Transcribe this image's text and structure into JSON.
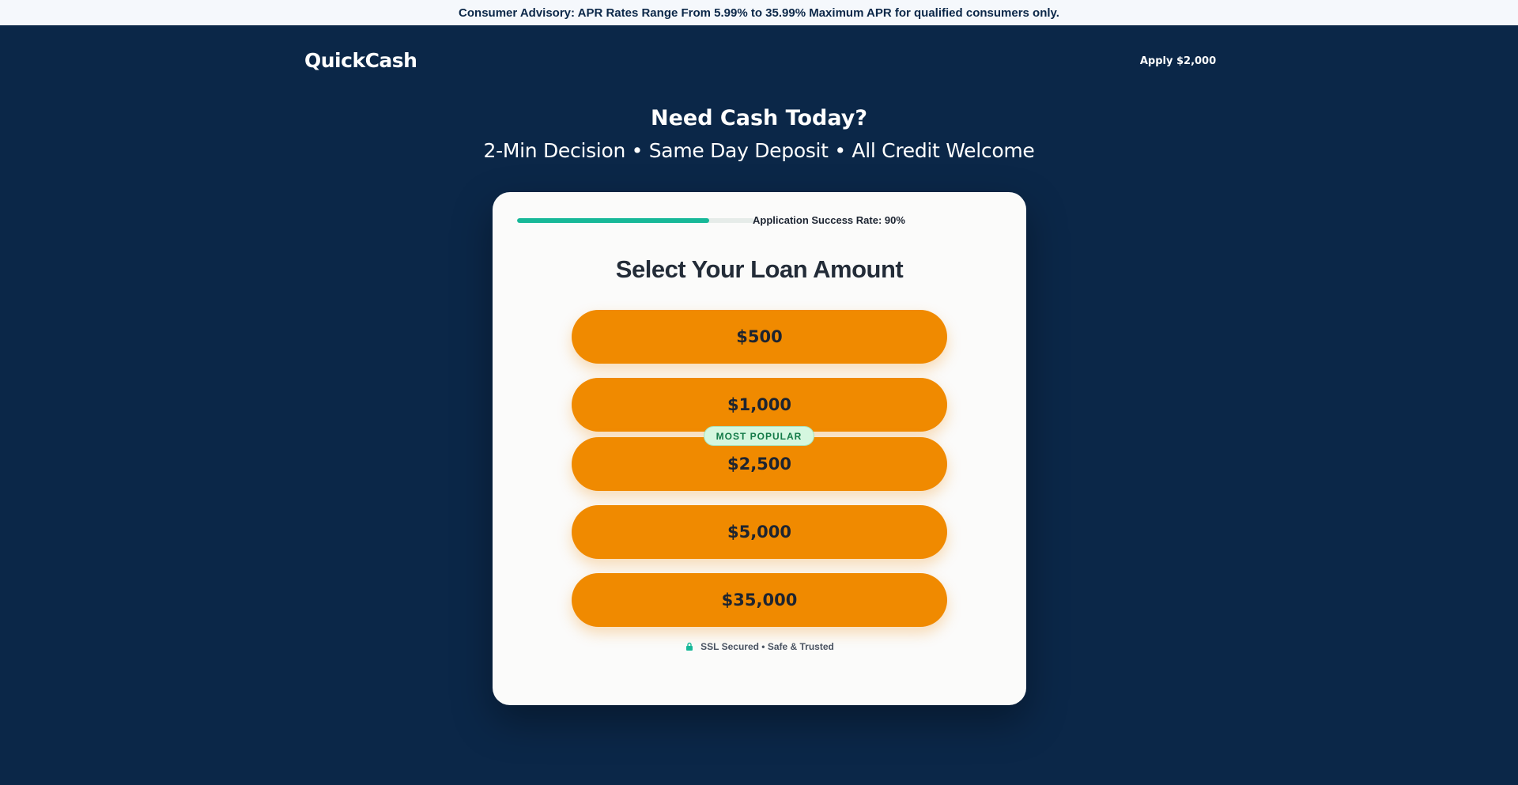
{
  "advisory": {
    "text": "Consumer Advisory: APR Rates Range From 5.99% to 35.99% Maximum APR for qualified consumers only."
  },
  "header": {
    "logo": "QuickCash",
    "cta_label": "Apply $2,000"
  },
  "hero": {
    "title": "Need Cash Today?",
    "subtitle": "2-Min Decision • Same Day Deposit • All Credit Welcome"
  },
  "card": {
    "progress": {
      "label": "Application Success Rate: 90%",
      "fill_fraction": 0.81
    },
    "title": "Select Your Loan Amount",
    "amounts": [
      {
        "label": "$500"
      },
      {
        "label": "$1,000"
      },
      {
        "label": "$2,500"
      },
      {
        "label": "$5,000"
      },
      {
        "label": "$35,000"
      }
    ],
    "badge": "MOST POPULAR",
    "secure_icon": "lock-icon",
    "secure_text": "SSL Secured • Safe & Trusted"
  },
  "colors": {
    "background": "#0b2748",
    "advisory_bg": "#f5f8fc",
    "accent": "#f08a00",
    "progress": "#17b898",
    "badge_bg": "#d5f7df",
    "badge_text": "#137a47"
  }
}
